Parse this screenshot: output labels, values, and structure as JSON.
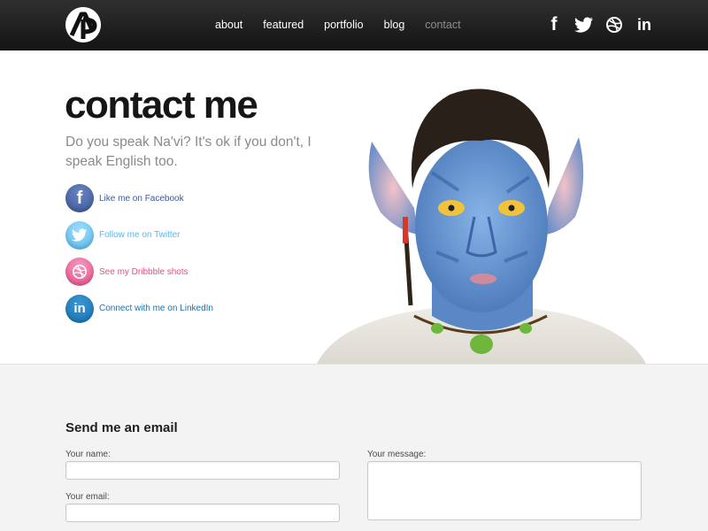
{
  "header": {
    "logo_icon": "ap-logo-icon",
    "nav": [
      {
        "label": "about",
        "active": false
      },
      {
        "label": "featured",
        "active": false
      },
      {
        "label": "portfolio",
        "active": false
      },
      {
        "label": "blog",
        "active": false
      },
      {
        "label": "contact",
        "active": true
      }
    ],
    "social": {
      "facebook": "f",
      "twitter_icon": "twitter-bird-icon",
      "dribbble_icon": "dribbble-icon",
      "linkedin": "in"
    }
  },
  "hero": {
    "title": "contact me",
    "subtitle": "Do you speak Na'vi? It's ok if you don't, I speak English too.",
    "image_icon": "navi-avatar-portrait",
    "links": [
      {
        "label": "Like me on Facebook",
        "icon": "facebook-icon",
        "glyph": "f",
        "color": "#3b5998"
      },
      {
        "label": "Follow me on Twitter",
        "icon": "twitter-icon",
        "color": "#55b9ec"
      },
      {
        "label": "See my Dribbble shots",
        "icon": "dribbble-icon",
        "color": "#ea4c89"
      },
      {
        "label": "Connect with me on LinkedIn",
        "icon": "linkedin-icon",
        "glyph": "in",
        "color": "#1773b3"
      }
    ]
  },
  "form": {
    "heading": "Send me an email",
    "name_label": "Your name:",
    "name_value": "",
    "email_label": "Your email:",
    "email_value": "",
    "message_label": "Your message:",
    "message_value": ""
  }
}
